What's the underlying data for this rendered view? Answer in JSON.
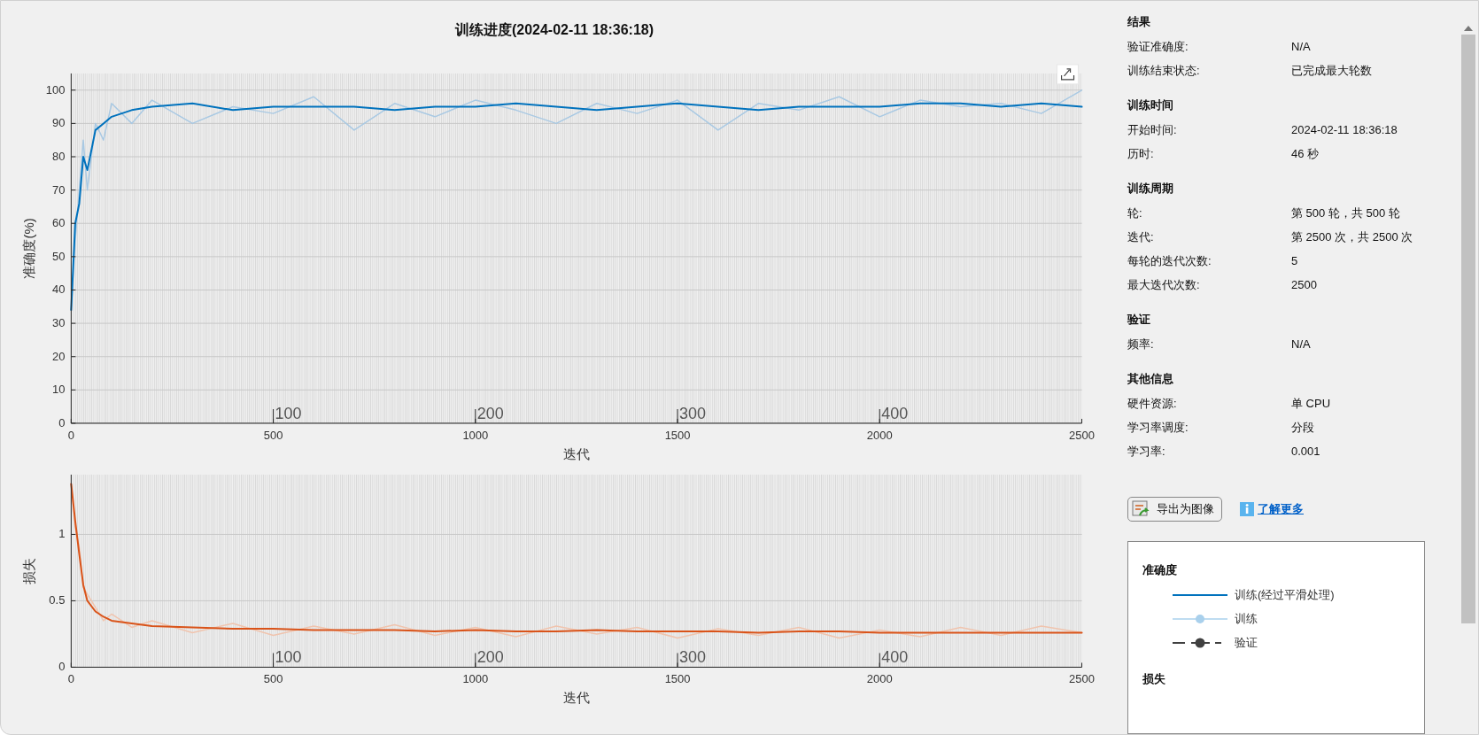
{
  "window": {
    "title": "训练进度(2024-02-11 18:36:18)"
  },
  "charts": [
    {
      "export_icon": true,
      "chart_data": {
        "type": "line",
        "grid": true,
        "ylabel": "准确度(%)",
        "xlabel": "迭代",
        "x": [
          0,
          10,
          20,
          30,
          40,
          60,
          80,
          100,
          150,
          200,
          300,
          400,
          500,
          600,
          700,
          800,
          900,
          1000,
          1100,
          1200,
          1300,
          1400,
          1500,
          1600,
          1700,
          1800,
          1900,
          2000,
          2100,
          2200,
          2300,
          2400,
          2500
        ],
        "xlim": [
          0,
          2500
        ],
        "ylim": [
          0,
          105
        ],
        "xticks": [
          0,
          500,
          1000,
          1500,
          2000,
          2500
        ],
        "yticks": [
          0,
          10,
          20,
          30,
          40,
          50,
          60,
          70,
          80,
          90,
          100
        ],
        "series": [
          {
            "color": "#0072bd",
            "values": [
              34,
              60,
              66,
              80,
              76,
              88,
              90,
              92,
              94,
              95,
              96,
              94,
              95,
              95,
              95,
              94,
              95,
              95,
              96,
              95,
              94,
              95,
              96,
              95,
              94,
              95,
              95,
              95,
              96,
              96,
              95,
              96,
              95
            ]
          },
          {
            "color": "#a9c9e3",
            "values": [
              34,
              55,
              70,
              85,
              70,
              90,
              85,
              96,
              90,
              97,
              90,
              95,
              93,
              98,
              88,
              96,
              92,
              97,
              94,
              90,
              96,
              93,
              97,
              88,
              96,
              94,
              98,
              92,
              97,
              95,
              96,
              93,
              100
            ]
          }
        ],
        "annotations": [
          "100",
          "200",
          "300",
          "400"
        ]
      }
    },
    {
      "chart_data": {
        "type": "line",
        "grid": true,
        "ylabel": "损失",
        "xlabel": "迭代",
        "x": [
          0,
          10,
          20,
          30,
          40,
          60,
          80,
          100,
          150,
          200,
          300,
          400,
          500,
          600,
          700,
          800,
          900,
          1000,
          1100,
          1200,
          1300,
          1400,
          1500,
          1600,
          1700,
          1800,
          1900,
          2000,
          2100,
          2200,
          2300,
          2400,
          2500
        ],
        "xlim": [
          0,
          2500
        ],
        "ylim": [
          0,
          1.45
        ],
        "xticks": [
          0,
          500,
          1000,
          1500,
          2000,
          2500
        ],
        "yticks": [
          0,
          0.5,
          1
        ],
        "series": [
          {
            "color": "#d95319",
            "values": [
              1.38,
              1.1,
              0.85,
              0.62,
              0.5,
              0.42,
              0.38,
              0.35,
              0.33,
              0.31,
              0.3,
              0.29,
              0.29,
              0.28,
              0.28,
              0.28,
              0.27,
              0.28,
              0.27,
              0.27,
              0.28,
              0.27,
              0.27,
              0.27,
              0.26,
              0.27,
              0.27,
              0.26,
              0.26,
              0.26,
              0.26,
              0.26,
              0.26
            ]
          },
          {
            "color": "#f0c4ae",
            "values": [
              1.38,
              1.05,
              0.9,
              0.6,
              0.55,
              0.45,
              0.35,
              0.4,
              0.3,
              0.35,
              0.26,
              0.33,
              0.24,
              0.31,
              0.25,
              0.32,
              0.24,
              0.3,
              0.23,
              0.31,
              0.25,
              0.3,
              0.22,
              0.29,
              0.24,
              0.3,
              0.22,
              0.28,
              0.23,
              0.3,
              0.24,
              0.31,
              0.26
            ]
          }
        ],
        "annotations": [
          "100",
          "200",
          "300",
          "400"
        ]
      }
    }
  ],
  "sections": [
    {
      "title": "结果",
      "rows": [
        {
          "label": "验证准确度:",
          "value": "N/A"
        },
        {
          "label": "训练结束状态:",
          "value": "已完成最大轮数"
        }
      ]
    },
    {
      "title": "训练时间",
      "rows": [
        {
          "label": "开始时间:",
          "value": "2024-02-11 18:36:18"
        },
        {
          "label": "历时:",
          "value": "46 秒"
        }
      ]
    },
    {
      "title": "训练周期",
      "rows": [
        {
          "label": "轮:",
          "value": "第 500 轮，共 500 轮"
        },
        {
          "label": "迭代:",
          "value": "第 2500 次，共 2500 次"
        },
        {
          "label": "每轮的迭代次数:",
          "value": "5"
        },
        {
          "label": "最大迭代次数:",
          "value": "2500"
        }
      ]
    },
    {
      "title": "验证",
      "rows": [
        {
          "label": "频率:",
          "value": "N/A"
        }
      ]
    },
    {
      "title": "其他信息",
      "rows": [
        {
          "label": "硬件资源:",
          "value": "单 CPU"
        },
        {
          "label": "学习率调度:",
          "value": "分段"
        },
        {
          "label": "学习率:",
          "value": "0.001"
        }
      ]
    }
  ],
  "export_button": {
    "label": "导出为图像"
  },
  "learn_more_link": {
    "label": "了解更多"
  },
  "legend": {
    "groups": [
      {
        "title": "准确度",
        "entries": [
          {
            "kind": "line",
            "label": "训练(经过平滑处理)",
            "color": "#0072bd"
          },
          {
            "kind": "marker-line",
            "label": "训练",
            "color": "#a9d0ec"
          },
          {
            "kind": "dashed-marker",
            "label": "验证",
            "color": "#404040"
          }
        ]
      },
      {
        "title": "损失"
      }
    ]
  }
}
